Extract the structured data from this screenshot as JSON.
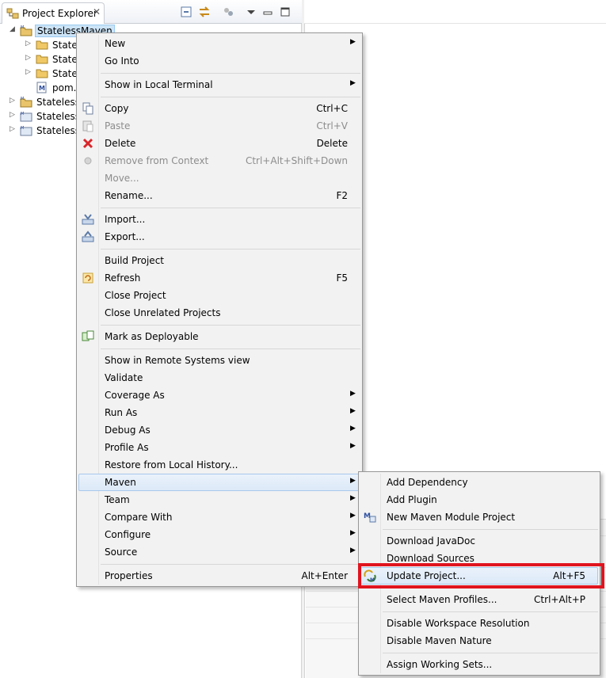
{
  "view": {
    "tab_title": "Project Explorer",
    "close_glyph": "✕"
  },
  "tree": [
    {
      "label": "StatelessMaven",
      "expanded": true,
      "selected": true
    },
    {
      "label": "StatelessM",
      "child": true,
      "type": "folder"
    },
    {
      "label": "StatelessM",
      "child": true,
      "type": "folder"
    },
    {
      "label": "StatelessM",
      "child": true,
      "type": "folder"
    },
    {
      "label": "pom.xml",
      "child": true,
      "type": "pom"
    },
    {
      "label": "StatelessM"
    },
    {
      "label": "StatelessM"
    },
    {
      "label": "StatelessM"
    }
  ],
  "menu": {
    "new": "New",
    "go_into": "Go Into",
    "show_local_terminal": "Show in Local Terminal",
    "copy": "Copy",
    "copy_sc": "Ctrl+C",
    "paste": "Paste",
    "paste_sc": "Ctrl+V",
    "delete": "Delete",
    "delete_sc": "Delete",
    "remove_ctx": "Remove from Context",
    "remove_ctx_sc": "Ctrl+Alt+Shift+Down",
    "move": "Move...",
    "rename": "Rename...",
    "rename_sc": "F2",
    "import": "Import...",
    "export": "Export...",
    "build": "Build Project",
    "refresh": "Refresh",
    "refresh_sc": "F5",
    "close_project": "Close Project",
    "close_unrelated": "Close Unrelated Projects",
    "mark_deployable": "Mark as Deployable",
    "show_remote": "Show in Remote Systems view",
    "validate": "Validate",
    "coverage_as": "Coverage As",
    "run_as": "Run As",
    "debug_as": "Debug As",
    "profile_as": "Profile As",
    "restore_history": "Restore from Local History...",
    "maven": "Maven",
    "team": "Team",
    "compare_with": "Compare With",
    "configure": "Configure",
    "source": "Source",
    "properties": "Properties",
    "properties_sc": "Alt+Enter"
  },
  "submenu": {
    "add_dependency": "Add Dependency",
    "add_plugin": "Add Plugin",
    "new_module": "New Maven Module Project",
    "download_javadoc": "Download JavaDoc",
    "download_sources": "Download Sources",
    "update_project": "Update Project...",
    "update_project_sc": "Alt+F5",
    "select_profiles": "Select Maven Profiles...",
    "select_profiles_sc": "Ctrl+Alt+P",
    "disable_workspace": "Disable Workspace Resolution",
    "disable_nature": "Disable Maven Nature",
    "assign_sets": "Assign Working Sets..."
  },
  "colors": {
    "highlight": "#e0141e",
    "selection": "#cce4f7"
  }
}
